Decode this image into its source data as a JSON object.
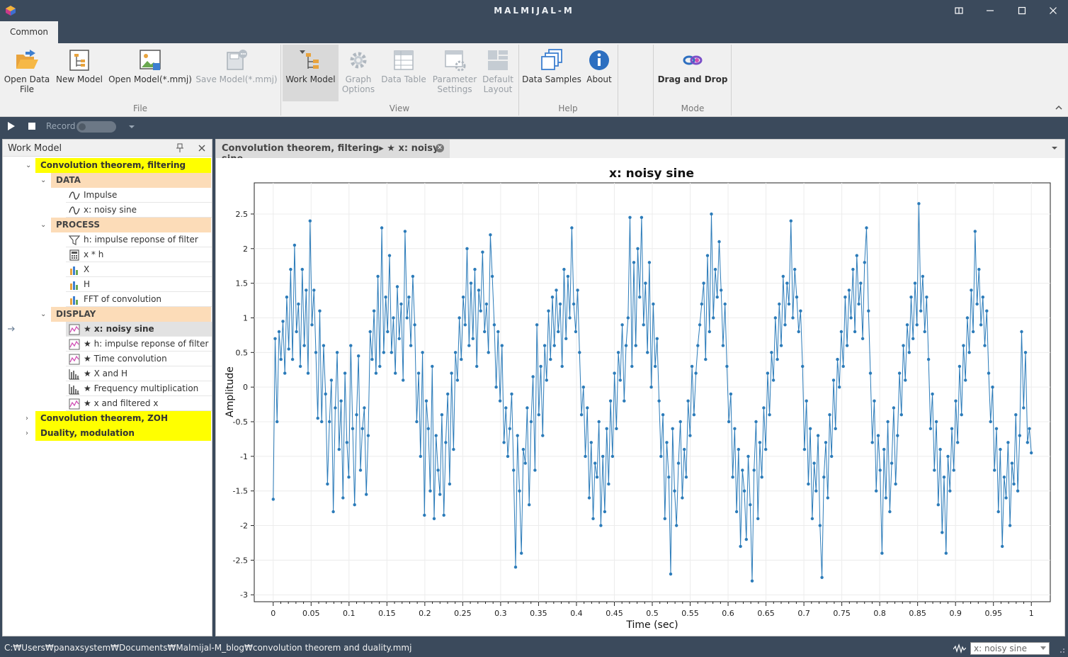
{
  "window": {
    "title": "MALMIJAL-M",
    "controls": [
      "restore-icon",
      "minimize-icon",
      "maximize-icon",
      "close-icon"
    ]
  },
  "ribbon": {
    "tab": "Common",
    "groups": [
      {
        "label": "File",
        "buttons": [
          {
            "label": "Open Data",
            "label2": "File",
            "icon": "folder-open-icon",
            "enabled": true
          },
          {
            "label": "New Model",
            "icon": "new-model-icon",
            "enabled": true
          },
          {
            "label": "Open Model(*.mmj)",
            "icon": "open-model-icon",
            "enabled": true
          },
          {
            "label": "Save Model(*.mmj)",
            "icon": "save-model-icon",
            "enabled": false
          }
        ]
      },
      {
        "label": "View",
        "buttons": [
          {
            "label": "Work Model",
            "icon": "work-model-icon",
            "enabled": true,
            "active": true
          },
          {
            "label": "Graph",
            "label2": "Options",
            "icon": "gear-icon",
            "enabled": false
          },
          {
            "label": "Data Table",
            "icon": "table-icon",
            "enabled": false
          },
          {
            "label": "Parameter",
            "label2": "Settings",
            "icon": "settings-icon",
            "enabled": false
          },
          {
            "label": "Default",
            "label2": "Layout",
            "icon": "layout-icon",
            "enabled": false
          }
        ]
      },
      {
        "label": "Help",
        "buttons": [
          {
            "label": "Data Samples",
            "icon": "samples-icon",
            "enabled": true
          },
          {
            "label": "About",
            "icon": "info-icon",
            "enabled": true
          }
        ]
      },
      {
        "label": "Mode",
        "buttons": [
          {
            "label": "Drag and Drop",
            "icon": "drag-drop-icon",
            "enabled": true
          }
        ]
      }
    ]
  },
  "record_bar": {
    "record_label": "Record"
  },
  "work_model": {
    "title": "Work Model",
    "projects": [
      {
        "label": "Convolution theorem, filtering",
        "expanded": true
      },
      {
        "label": "Convolution theorem, ZOH",
        "expanded": false
      },
      {
        "label": "Duality, modulation",
        "expanded": false
      }
    ],
    "sections": [
      {
        "label": "DATA",
        "items": [
          {
            "label": "Impulse",
            "icon": "signal-icon"
          },
          {
            "label": "x: noisy sine",
            "icon": "signal-icon"
          }
        ]
      },
      {
        "label": "PROCESS",
        "items": [
          {
            "label": "h: impulse reponse of filter",
            "icon": "filter-icon"
          },
          {
            "label": "x * h",
            "icon": "calculator-icon"
          },
          {
            "label": "X",
            "icon": "bar-chart-icon"
          },
          {
            "label": "H",
            "icon": "bar-chart-icon"
          },
          {
            "label": "FFT of convolution",
            "icon": "bar-chart-icon"
          }
        ]
      },
      {
        "label": "DISPLAY",
        "items": [
          {
            "label": "★ x: noisy sine",
            "icon": "line-plot-icon",
            "selected": true
          },
          {
            "label": "★ h: impulse reponse of filter",
            "icon": "line-plot-icon"
          },
          {
            "label": "★ Time convolution",
            "icon": "line-plot-icon"
          },
          {
            "label": "★ X and H",
            "icon": "stem-plot-icon"
          },
          {
            "label": "★ Frequency multiplication",
            "icon": "stem-plot-icon"
          },
          {
            "label": "★ x and filtered x",
            "icon": "line-plot-icon"
          }
        ]
      }
    ]
  },
  "document_tab": {
    "title": "Convolution theorem, filtering▸ ★ x: noisy sine"
  },
  "status": {
    "path": "C:₩Users₩panaxsystem₩Documents₩Malmijal-M_blog₩convolution theorem and duality.mmj",
    "selected_plot": "x: noisy sine"
  },
  "chart_data": {
    "type": "line",
    "title": "x: noisy sine",
    "xlabel": "Time (sec)",
    "ylabel": "Amplitude",
    "xlim": [
      -0.025,
      1.025
    ],
    "ylim": [
      -3.1,
      2.95
    ],
    "xticks": [
      0,
      0.05,
      0.1,
      0.15,
      0.2,
      0.25,
      0.3,
      0.35,
      0.4,
      0.45,
      0.5,
      0.55,
      0.6,
      0.65,
      0.7,
      0.75,
      0.8,
      0.85,
      0.9,
      0.95,
      1
    ],
    "xtick_labels": [
      "0",
      "0.05",
      "0.1",
      "0.15",
      "0.2",
      "0.25",
      "0.3",
      "0.35",
      "0.4",
      "0.45",
      "0.5",
      "0.55",
      "0.6",
      "0.65",
      "0.7",
      "0.75",
      "0.8",
      "0.85",
      "0.9",
      "0.95",
      "1"
    ],
    "yticks": [
      -3,
      -2.5,
      -2,
      -1.5,
      -1,
      -0.5,
      0,
      0.5,
      1,
      1.5,
      2,
      2.5
    ],
    "ytick_labels": [
      "-3",
      "-2.5",
      "-2",
      "-1.5",
      "-1",
      "-0.5",
      "0",
      "0.5",
      "1",
      "1.5",
      "2",
      "2.5"
    ],
    "grid": true,
    "series": [
      {
        "color": "#2b7bb9",
        "markers": true,
        "x_start": 0,
        "x_end": 1,
        "y": [
          -1.62,
          0.7,
          -0.5,
          0.8,
          0.4,
          0.95,
          0.2,
          1.3,
          0.55,
          1.7,
          0.4,
          2.05,
          0.8,
          1.2,
          0.3,
          1.7,
          0.6,
          1.4,
          0.2,
          2.4,
          0.9,
          1.4,
          0.5,
          -0.45,
          1.1,
          -0.5,
          0.6,
          -0.1,
          -1.4,
          -0.5,
          0.1,
          -1.8,
          -0.3,
          0.5,
          -0.9,
          -0.2,
          -1.6,
          0.2,
          -0.8,
          -1.3,
          0.6,
          -0.6,
          -1.7,
          -0.4,
          0.45,
          -1.2,
          -0.6,
          -0.3,
          -1.55,
          -0.7,
          0.8,
          0.4,
          1.1,
          0.2,
          1.6,
          0.3,
          2.3,
          0.5,
          1.3,
          0.8,
          1.9,
          0.5,
          1.0,
          0.2,
          1.45,
          0.7,
          1.2,
          0.1,
          2.25,
          1.0,
          1.3,
          0.6,
          1.6,
          0.9,
          -0.5,
          0.2,
          -1.0,
          0.5,
          -1.85,
          -0.2,
          -0.6,
          -1.5,
          0.3,
          -1.9,
          -0.7,
          -1.2,
          -1.55,
          -0.4,
          -1.85,
          -0.8,
          -0.1,
          -1.4,
          0.2,
          -0.9,
          0.5,
          0.1,
          1.0,
          0.4,
          1.3,
          0.9,
          2.0,
          0.6,
          1.5,
          0.7,
          1.7,
          0.3,
          1.4,
          1.1,
          1.95,
          0.8,
          1.2,
          0.5,
          2.2,
          1.6,
          0.9,
          0.0,
          0.8,
          -0.2,
          0.6,
          -0.8,
          -0.3,
          -1.0,
          -0.6,
          -0.1,
          -1.2,
          -2.6,
          -0.7,
          -1.5,
          -2.4,
          -0.9,
          -1.1,
          -0.3,
          -1.7,
          -0.5,
          0.15,
          -1.2,
          0.9,
          -0.4,
          0.3,
          -0.7,
          0.6,
          0.1,
          1.1,
          0.4,
          1.3,
          0.6,
          1.4,
          0.8,
          1.2,
          0.3,
          1.7,
          0.7,
          1.6,
          1.0,
          2.3,
          1.2,
          0.8,
          1.4,
          0.5,
          -0.4,
          0.0,
          -1.0,
          -0.3,
          -1.6,
          -0.8,
          -1.9,
          -1.1,
          -1.3,
          -0.5,
          -2.0,
          -1.0,
          -1.8,
          -0.6,
          -1.4,
          -0.2,
          -1.0,
          0.2,
          -0.6,
          0.5,
          0.1,
          0.9,
          -0.2,
          0.6,
          1.0,
          2.45,
          0.3,
          1.8,
          0.6,
          2.0,
          1.3,
          2.45,
          0.9,
          1.5,
          0.5,
          1.8,
          0.0,
          1.2,
          0.3,
          0.7,
          -0.2,
          -1.0,
          -0.4,
          -1.9,
          -0.8,
          -1.3,
          -2.7,
          -0.6,
          -1.5,
          -2.0,
          -1.1,
          -0.5,
          -1.6,
          -0.9,
          -1.3,
          -0.2,
          -0.7,
          0.3,
          -0.4,
          0.2,
          0.6,
          0.9,
          1.2,
          1.5,
          0.4,
          1.9,
          0.8,
          2.5,
          1.0,
          1.7,
          1.3,
          2.1,
          1.4,
          0.6,
          1.2,
          0.3,
          -0.5,
          -0.1,
          -1.3,
          -0.6,
          -1.8,
          -0.9,
          -2.3,
          -1.2,
          -1.5,
          -2.2,
          -1.0,
          -1.7,
          -2.8,
          -1.2,
          -0.5,
          -1.9,
          -0.8,
          -1.3,
          -0.3,
          -0.9,
          0.2,
          -0.4,
          0.5,
          0.1,
          1.0,
          0.4,
          1.2,
          0.6,
          1.6,
          0.9,
          1.5,
          1.2,
          2.4,
          1.0,
          1.7,
          1.3,
          0.8,
          1.1,
          0.3,
          -0.9,
          -0.2,
          -1.4,
          -0.6,
          -1.9,
          -1.1,
          -1.5,
          -0.7,
          -2.0,
          -2.75,
          -1.3,
          -0.8,
          -1.6,
          -0.4,
          -1.0,
          0.1,
          -0.6,
          0.4,
          0.0,
          0.8,
          0.3,
          1.3,
          0.6,
          1.4,
          1.0,
          1.7,
          0.8,
          1.9,
          1.2,
          1.5,
          0.7,
          1.8,
          2.3,
          1.1,
          0.2,
          -0.8,
          -0.2,
          -1.5,
          -0.7,
          -1.2,
          -2.4,
          -0.9,
          -1.6,
          -0.5,
          -1.8,
          -1.1,
          -0.3,
          -1.4,
          -0.7,
          0.2,
          -0.4,
          0.6,
          0.1,
          0.9,
          0.5,
          1.3,
          0.7,
          1.5,
          0.9,
          2.65,
          1.1,
          1.6,
          0.8,
          1.3,
          0.4,
          -0.6,
          -0.1,
          -1.2,
          -0.5,
          -1.7,
          -0.9,
          -2.1,
          -1.3,
          -2.4,
          -1.0,
          -1.5,
          -0.6,
          -1.2,
          -0.2,
          -0.8,
          0.3,
          -0.4,
          0.6,
          0.1,
          1.0,
          0.5,
          1.4,
          0.8,
          2.25,
          1.2,
          1.7,
          0.9,
          1.3,
          0.6,
          1.1,
          0.2,
          -0.5,
          0.0,
          -1.2,
          -0.6,
          -1.8,
          -0.9,
          -2.3,
          -1.3,
          -1.6,
          -0.8,
          -2.0,
          -1.1,
          -1.4,
          -0.4,
          -1.5,
          -0.7,
          0.8,
          -0.3,
          0.5,
          -0.8,
          -0.6,
          -0.95
        ]
      }
    ]
  }
}
